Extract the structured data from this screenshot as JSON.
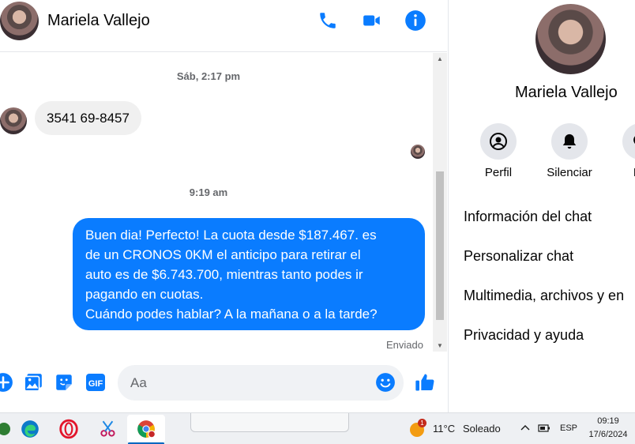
{
  "header": {
    "contact_name": "Mariela Vallejo",
    "icons": [
      "phone-icon",
      "video-icon",
      "info-icon"
    ],
    "accent_color": "#0a7cff"
  },
  "chat": {
    "timestamp_1": "Sáb, 2:17 pm",
    "incoming_message": "3541 69-8457",
    "timestamp_2": "9:19 am",
    "outgoing_lines": [
      "Buen dia! Perfecto! La cuota desde $187.467. es",
      "de un CRONOS 0KM el anticipo para retirar el",
      "auto es de $6.743.700, mientras tanto podes ir",
      "pagando en cuotas.",
      "Cuándo podes hablar? A la mañana o a la tarde?"
    ],
    "status": "Enviado"
  },
  "composer": {
    "placeholder": "Aa",
    "icons": [
      "plus-icon",
      "image-icon",
      "sticker-icon",
      "gif-icon",
      "emoji-icon",
      "like-icon"
    ],
    "gif_label": "GIF"
  },
  "right_panel": {
    "name": "Mariela Vallejo",
    "actions": [
      {
        "label": "Perfil",
        "icon": "profile-icon"
      },
      {
        "label": "Silenciar",
        "icon": "bell-icon"
      },
      {
        "label": "Bu",
        "icon": "search-icon"
      }
    ],
    "menu": [
      "Información del chat",
      "Personalizar chat",
      "Multimedia, archivos y en",
      "Privacidad y ayuda"
    ]
  },
  "taskbar": {
    "weather_temp": "11°C",
    "weather_text": "Soleado",
    "weather_badge": "1",
    "language": "ESP",
    "time": "09:19",
    "date": "17/6/2024"
  }
}
